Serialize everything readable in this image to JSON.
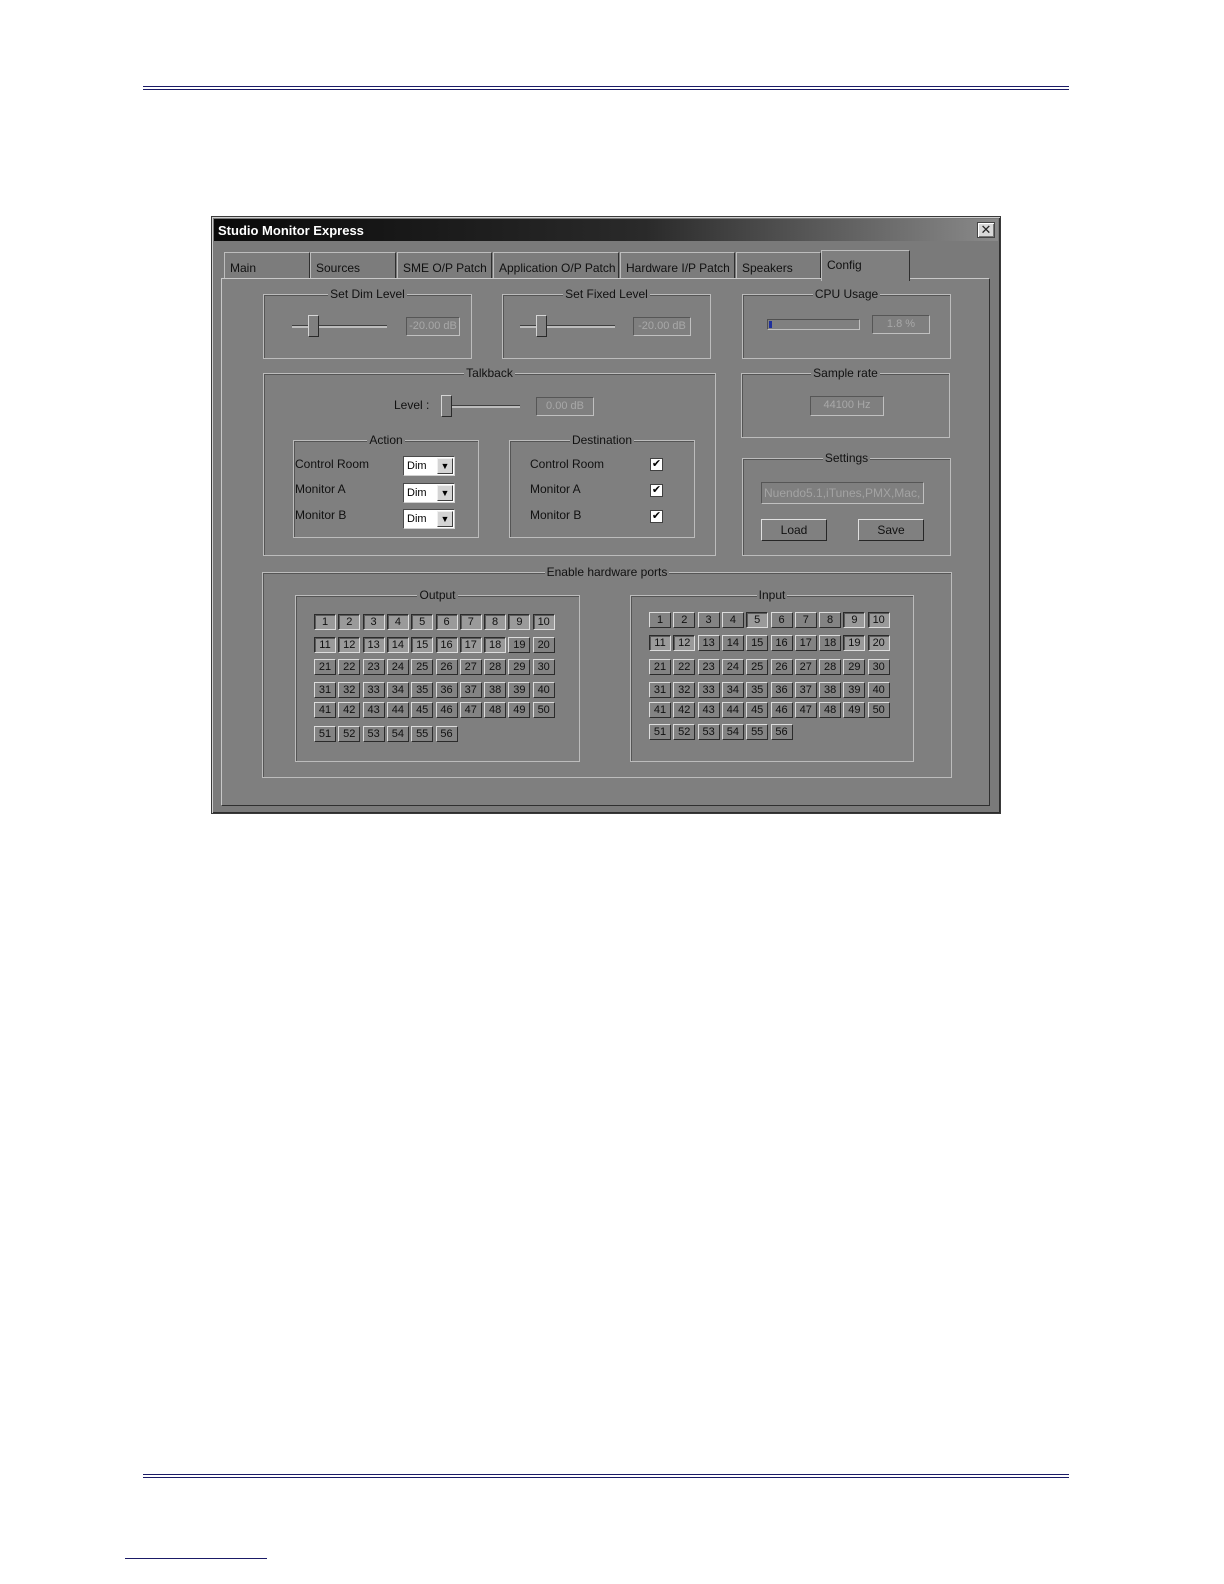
{
  "window": {
    "title": "Studio Monitor Express",
    "close_glyph": "✕"
  },
  "tabs": [
    {
      "label": "Main",
      "active": false
    },
    {
      "label": "Sources",
      "active": false
    },
    {
      "label": "SME O/P Patch",
      "active": false
    },
    {
      "label": "Application O/P Patch",
      "active": false
    },
    {
      "label": "Hardware I/P Patch",
      "active": false
    },
    {
      "label": "Speakers",
      "active": false
    },
    {
      "label": "Config",
      "active": true
    }
  ],
  "dim_level": {
    "legend": "Set Dim Level",
    "value": "-20.00 dB"
  },
  "fixed_level": {
    "legend": "Set Fixed Level",
    "value": "-20.00 dB"
  },
  "cpu": {
    "legend": "CPU Usage",
    "value": "1.8 %",
    "fraction": 0.018
  },
  "talkback": {
    "legend": "Talkback",
    "level_label": "Level :",
    "level_value": "0.00 dB",
    "action": {
      "legend": "Action",
      "rows": [
        {
          "label": "Control Room",
          "value": "Dim"
        },
        {
          "label": "Monitor A",
          "value": "Dim"
        },
        {
          "label": "Monitor B",
          "value": "Dim"
        }
      ]
    },
    "destination": {
      "legend": "Destination",
      "rows": [
        {
          "label": "Control Room",
          "checked": true
        },
        {
          "label": "Monitor A",
          "checked": true
        },
        {
          "label": "Monitor B",
          "checked": true
        }
      ],
      "check_glyph": "✔"
    }
  },
  "sample_rate": {
    "legend": "Sample rate",
    "value": "44100 Hz"
  },
  "settings": {
    "legend": "Settings",
    "file_value": "Nuendo5.1,iTunes,PMX,Mac,",
    "load_label": "Load",
    "save_label": "Save"
  },
  "hardware_ports": {
    "legend": "Enable hardware ports",
    "output": {
      "legend": "Output",
      "count": 56,
      "enabled": [
        1,
        2,
        3,
        4,
        5,
        6,
        7,
        8,
        9,
        10,
        11,
        12,
        13,
        14,
        15,
        16,
        17,
        18
      ]
    },
    "input": {
      "legend": "Input",
      "count": 56,
      "enabled": [
        5,
        9,
        10,
        11,
        12,
        19,
        20
      ]
    }
  }
}
